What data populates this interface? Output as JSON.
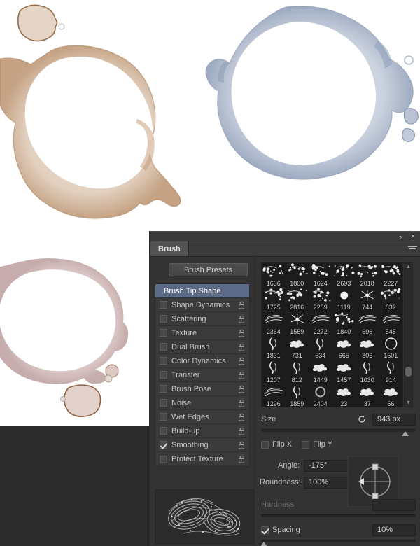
{
  "panel": {
    "title_tab": "Brush",
    "window_controls": {
      "collapse": "«",
      "close": "×"
    },
    "menu_icon": "panel-menu-icon",
    "presets_button": "Brush Presets"
  },
  "options": {
    "header": "Brush Tip Shape",
    "items": [
      {
        "label": "Shape Dynamics",
        "checked": false,
        "locked": false
      },
      {
        "label": "Scattering",
        "checked": false,
        "locked": false
      },
      {
        "label": "Texture",
        "checked": false,
        "locked": false
      },
      {
        "label": "Dual Brush",
        "checked": false,
        "locked": false
      },
      {
        "label": "Color Dynamics",
        "checked": false,
        "locked": false
      },
      {
        "label": "Transfer",
        "checked": false,
        "locked": false
      },
      {
        "label": "Brush Pose",
        "checked": false,
        "locked": false
      },
      {
        "label": "Noise",
        "checked": false,
        "locked": false
      },
      {
        "label": "Wet Edges",
        "checked": false,
        "locked": false
      },
      {
        "label": "Build-up",
        "checked": false,
        "locked": false
      },
      {
        "label": "Smoothing",
        "checked": true,
        "locked": false
      },
      {
        "label": "Protect Texture",
        "checked": false,
        "locked": false
      }
    ]
  },
  "brush_grid": {
    "rows": [
      [
        "1636",
        "1800",
        "1624",
        "2693",
        "2018",
        "2227"
      ],
      [
        "1725",
        "2816",
        "2259",
        "1119",
        "744",
        "832"
      ],
      [
        "2364",
        "1559",
        "2272",
        "1840",
        "696",
        "545"
      ],
      [
        "1831",
        "731",
        "534",
        "665",
        "806",
        "1501"
      ],
      [
        "1207",
        "812",
        "1449",
        "1457",
        "1030",
        "914"
      ],
      [
        "1296",
        "1859",
        "2404",
        "23",
        "37",
        "56"
      ]
    ],
    "scroll_up_icon": "▲",
    "scroll_down_icon": "▼"
  },
  "controls": {
    "size": {
      "label": "Size",
      "value": "943 px",
      "slider_pct": 93,
      "reset_icon": "reset-icon"
    },
    "flip_x": {
      "label": "Flip X",
      "checked": false
    },
    "flip_y": {
      "label": "Flip Y",
      "checked": false
    },
    "angle": {
      "label": "Angle:",
      "value": "-175°"
    },
    "roundness": {
      "label": "Roundness:",
      "value": "100%"
    },
    "hardness": {
      "label": "Hardness",
      "value": "",
      "enabled": false,
      "slider_pct": 0
    },
    "spacing": {
      "label": "Spacing",
      "value": "10%",
      "checked": true,
      "slider_pct": 2
    }
  },
  "colors": {
    "panel_bg": "#333333",
    "header_accent": "#5b6a86",
    "grid_bg": "#1c1c1c",
    "stain_brown": "#c9a98e",
    "stain_blue": "#9aa8c2",
    "stain_pink": "#cbb0b0"
  },
  "artwork": {
    "stain_brown_name": "coffee-ring-stain-brown",
    "stain_blue_name": "coffee-ring-stain-blue",
    "stain_pink_name": "coffee-ring-stain-pink",
    "stroke_preview_name": "brush-stroke-preview"
  }
}
